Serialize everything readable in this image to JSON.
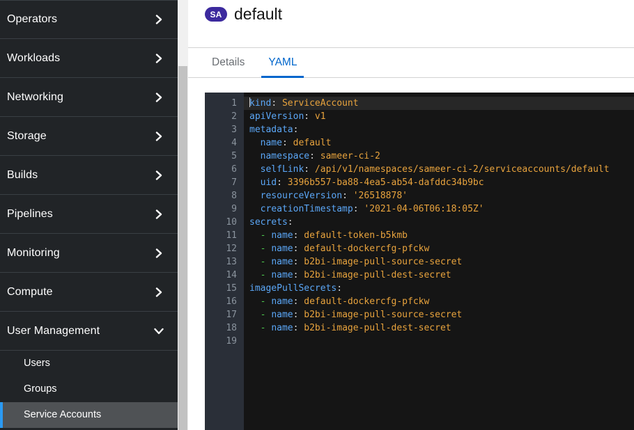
{
  "sidebar": {
    "items": [
      {
        "label": "Operators",
        "icon": "chevron-right-icon",
        "expanded": false
      },
      {
        "label": "Workloads",
        "icon": "chevron-right-icon",
        "expanded": false
      },
      {
        "label": "Networking",
        "icon": "chevron-right-icon",
        "expanded": false
      },
      {
        "label": "Storage",
        "icon": "chevron-right-icon",
        "expanded": false
      },
      {
        "label": "Builds",
        "icon": "chevron-right-icon",
        "expanded": false
      },
      {
        "label": "Pipelines",
        "icon": "chevron-right-icon",
        "expanded": false
      },
      {
        "label": "Monitoring",
        "icon": "chevron-right-icon",
        "expanded": false
      },
      {
        "label": "Compute",
        "icon": "chevron-right-icon",
        "expanded": false
      },
      {
        "label": "User Management",
        "icon": "chevron-down-icon",
        "expanded": true
      }
    ],
    "sub_items": [
      {
        "label": "Users",
        "active": false
      },
      {
        "label": "Groups",
        "active": false
      },
      {
        "label": "Service Accounts",
        "active": true
      }
    ],
    "active_accent_color": "#2b9af3",
    "background_color": "#212427"
  },
  "header": {
    "badge": "SA",
    "badge_color": "#3c2a9e",
    "title": "default"
  },
  "tabs": [
    {
      "label": "Details",
      "active": false
    },
    {
      "label": "YAML",
      "active": true
    }
  ],
  "tab_accent_color": "#0066cc",
  "editor": {
    "line_numbers": [
      "1",
      "2",
      "3",
      "4",
      "5",
      "6",
      "7",
      "8",
      "9",
      "10",
      "11",
      "12",
      "13",
      "14",
      "15",
      "16",
      "17",
      "18",
      "19"
    ],
    "active_line": 1,
    "lines": [
      {
        "n": 1,
        "key": "kind",
        "indent": 0,
        "colon": ":",
        "value": "ServiceAccount",
        "dash": false
      },
      {
        "n": 2,
        "key": "apiVersion",
        "indent": 0,
        "colon": ":",
        "value": "v1",
        "dash": false
      },
      {
        "n": 3,
        "key": "metadata",
        "indent": 0,
        "colon": ":",
        "value": "",
        "dash": false
      },
      {
        "n": 4,
        "key": "name",
        "indent": 2,
        "colon": ":",
        "value": "default",
        "dash": false
      },
      {
        "n": 5,
        "key": "namespace",
        "indent": 2,
        "colon": ":",
        "value": "sameer-ci-2",
        "dash": false
      },
      {
        "n": 6,
        "key": "selfLink",
        "indent": 2,
        "colon": ":",
        "value": "/api/v1/namespaces/sameer-ci-2/serviceaccounts/default",
        "dash": false
      },
      {
        "n": 7,
        "key": "uid",
        "indent": 2,
        "colon": ":",
        "value": "3396b557-ba88-4ea5-ab54-dafddc34b9bc",
        "dash": false
      },
      {
        "n": 8,
        "key": "resourceVersion",
        "indent": 2,
        "colon": ":",
        "value": "'26518878'",
        "dash": false
      },
      {
        "n": 9,
        "key": "creationTimestamp",
        "indent": 2,
        "colon": ":",
        "value": "'2021-04-06T06:18:05Z'",
        "dash": false
      },
      {
        "n": 10,
        "key": "secrets",
        "indent": 0,
        "colon": ":",
        "value": "",
        "dash": false
      },
      {
        "n": 11,
        "key": "name",
        "indent": 2,
        "colon": ":",
        "value": "default-token-b5kmb",
        "dash": true
      },
      {
        "n": 12,
        "key": "name",
        "indent": 2,
        "colon": ":",
        "value": "default-dockercfg-pfckw",
        "dash": true
      },
      {
        "n": 13,
        "key": "name",
        "indent": 2,
        "colon": ":",
        "value": "b2bi-image-pull-source-secret",
        "dash": true
      },
      {
        "n": 14,
        "key": "name",
        "indent": 2,
        "colon": ":",
        "value": "b2bi-image-pull-dest-secret",
        "dash": true
      },
      {
        "n": 15,
        "key": "imagePullSecrets",
        "indent": 0,
        "colon": ":",
        "value": "",
        "dash": false
      },
      {
        "n": 16,
        "key": "name",
        "indent": 2,
        "colon": ":",
        "value": "default-dockercfg-pfckw",
        "dash": true
      },
      {
        "n": 17,
        "key": "name",
        "indent": 2,
        "colon": ":",
        "value": "b2bi-image-pull-source-secret",
        "dash": true
      },
      {
        "n": 18,
        "key": "name",
        "indent": 2,
        "colon": ":",
        "value": "b2bi-image-pull-dest-secret",
        "dash": true
      },
      {
        "n": 19,
        "key": "",
        "indent": 0,
        "colon": "",
        "value": "",
        "dash": false
      }
    ],
    "colors": {
      "background": "#151515",
      "gutter_background": "#2a2f38",
      "line_number": "#8b949e",
      "key": "#5ba7f7",
      "value": "#e8a33d",
      "dash": "#4ec94e",
      "punctuation": "#d4d4d4"
    }
  },
  "scrollbar": {
    "present": true
  }
}
